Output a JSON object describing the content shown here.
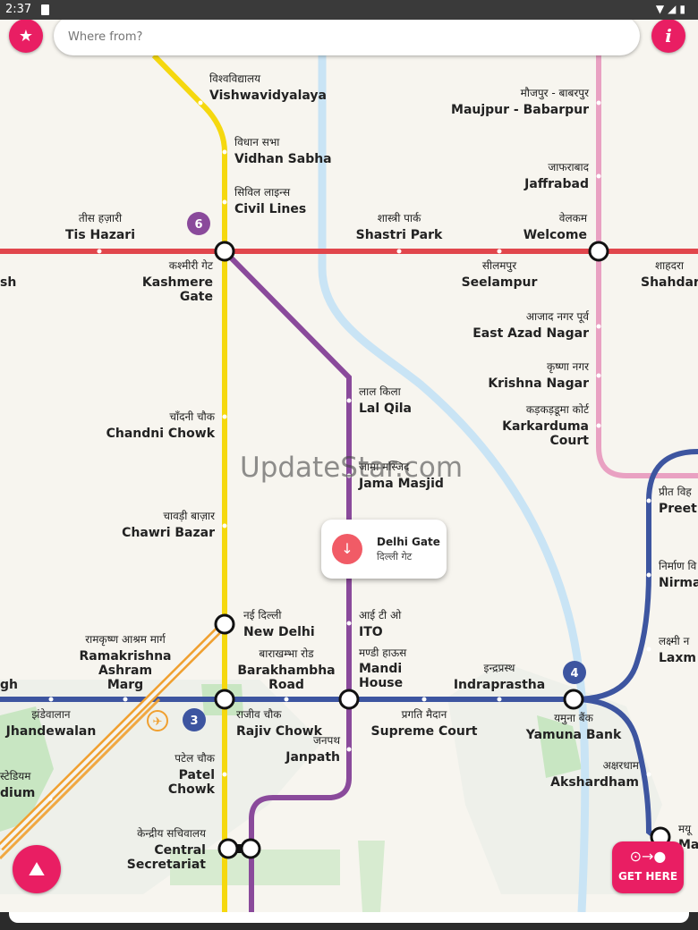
{
  "status_bar": {
    "time": "2:37",
    "icons": [
      "sd-card-icon",
      "wifi-icon",
      "signal-icon",
      "battery-icon"
    ]
  },
  "search": {
    "placeholder": "Where from?"
  },
  "buttons": {
    "info_label": "i",
    "get_here_label": "GET HERE"
  },
  "watermark": "UpdateStar.com",
  "popup": {
    "en": "Delhi Gate",
    "hi": "दिल्ली गेट"
  },
  "colors": {
    "accent": "#e91e63",
    "yellow_line": "#f5d80f",
    "red_line": "#e1464c",
    "blue_line": "#3d55a0",
    "violet_line": "#8a4a9b",
    "pink_line": "#e9a1c2",
    "airport_line": "#f0a030"
  },
  "line_badges": {
    "red": "6",
    "blue": "3",
    "blue_branch": "4"
  },
  "stations": {
    "vishwavidyalaya": {
      "hi": "विश्वविद्यालय",
      "en": "Vishwavidyalaya"
    },
    "vidhan_sabha": {
      "hi": "विधान सभा",
      "en": "Vidhan Sabha"
    },
    "civil_lines": {
      "hi": "सिविल लाइन्स",
      "en": "Civil Lines"
    },
    "tis_hazari": {
      "hi": "तीस हज़ारी",
      "en": "Tis Hazari"
    },
    "kashmere_gate": {
      "hi": "कश्मीरी गेट",
      "en1": "Kashmere",
      "en2": "Gate"
    },
    "shastri_park": {
      "hi": "शास्त्री पार्क",
      "en": "Shastri Park"
    },
    "welcome": {
      "hi": "वेलकम",
      "en": "Welcome"
    },
    "seelampur": {
      "hi": "सीलमपुर",
      "en": "Seelampur"
    },
    "shahdara": {
      "hi": "शाहदरा",
      "en": "Shahdar"
    },
    "pul_bangash": {
      "en": "sh"
    },
    "maujpur": {
      "hi": "मौजपुर - बाबरपुर",
      "en": "Maujpur - Babarpur"
    },
    "jaffrabad": {
      "hi": "जाफराबाद",
      "en": "Jaffrabad"
    },
    "east_azad_nagar": {
      "hi": "आजाद नगर पूर्व",
      "en": "East Azad Nagar"
    },
    "krishna_nagar": {
      "hi": "कृष्णा नगर",
      "en": "Krishna Nagar"
    },
    "karkarduma": {
      "hi": "कड़कड़डूमा कोर्ट",
      "en1": "Karkarduma",
      "en2": "Court"
    },
    "lal_qila": {
      "hi": "लाल किला",
      "en": "Lal Qila"
    },
    "jama_masjid": {
      "hi": "जामा मस्जिद",
      "en": "Jama Masjid"
    },
    "chandni_chowk": {
      "hi": "चाँदनी चौक",
      "en": "Chandni Chowk"
    },
    "chawri_bazar": {
      "hi": "चावड़ी बाज़ार",
      "en": "Chawri Bazar"
    },
    "preet_vihar": {
      "hi": "प्रीत विह",
      "en": "Preet"
    },
    "nirman_vihar": {
      "hi": "निर्माण वि",
      "en": "Nirma"
    },
    "laxmi_nagar": {
      "hi": "लक्ष्मी न",
      "en": "Laxm"
    },
    "new_delhi": {
      "hi": "नई दिल्ली",
      "en": "New Delhi"
    },
    "ito": {
      "hi": "आई टी ओ",
      "en": "ITO"
    },
    "mandi_house": {
      "hi": "मण्डी हाऊस",
      "en1": "Mandi",
      "en2": "House"
    },
    "rk_ashram": {
      "hi": "रामकृष्ण आश्रम मार्ग",
      "en1": "Ramakrishna",
      "en2": "Ashram",
      "en3": "Marg"
    },
    "barakhamba": {
      "hi": "बाराखम्भा रोड",
      "en1": "Barakhambha",
      "en2": "Road"
    },
    "indraprastha": {
      "hi": "इन्द्रप्रस्थ",
      "en": "Indraprastha"
    },
    "jhandewalan": {
      "hi": "झंडेवालान",
      "en": "Jhandewalan"
    },
    "rajiv_chowk": {
      "hi": "राजीव चौक",
      "en": "Rajiv Chowk"
    },
    "janpath": {
      "hi": "जनपथ",
      "en": "Janpath"
    },
    "pragati_maidan": {
      "hi": "प्रगति मैदान",
      "en": "Supreme Court"
    },
    "yamuna_bank": {
      "hi": "यमुना बैंक",
      "en": "Yamuna Bank"
    },
    "akshardham": {
      "hi": "अक्षरधाम",
      "en": "Akshardham"
    },
    "karol_bagh": {
      "en": "gh"
    },
    "patel_chowk": {
      "hi": "पटेल चौक",
      "en1": "Patel",
      "en2": "Chowk"
    },
    "central_secretariat": {
      "hi": "केन्द्रीय सचिवालय",
      "en1": "Central",
      "en2": "Secretariat"
    },
    "stadium": {
      "hi": "स्टेडियम",
      "en": "dium"
    },
    "mayur_vihar": {
      "hi": "मयू",
      "en": "Ma"
    }
  }
}
